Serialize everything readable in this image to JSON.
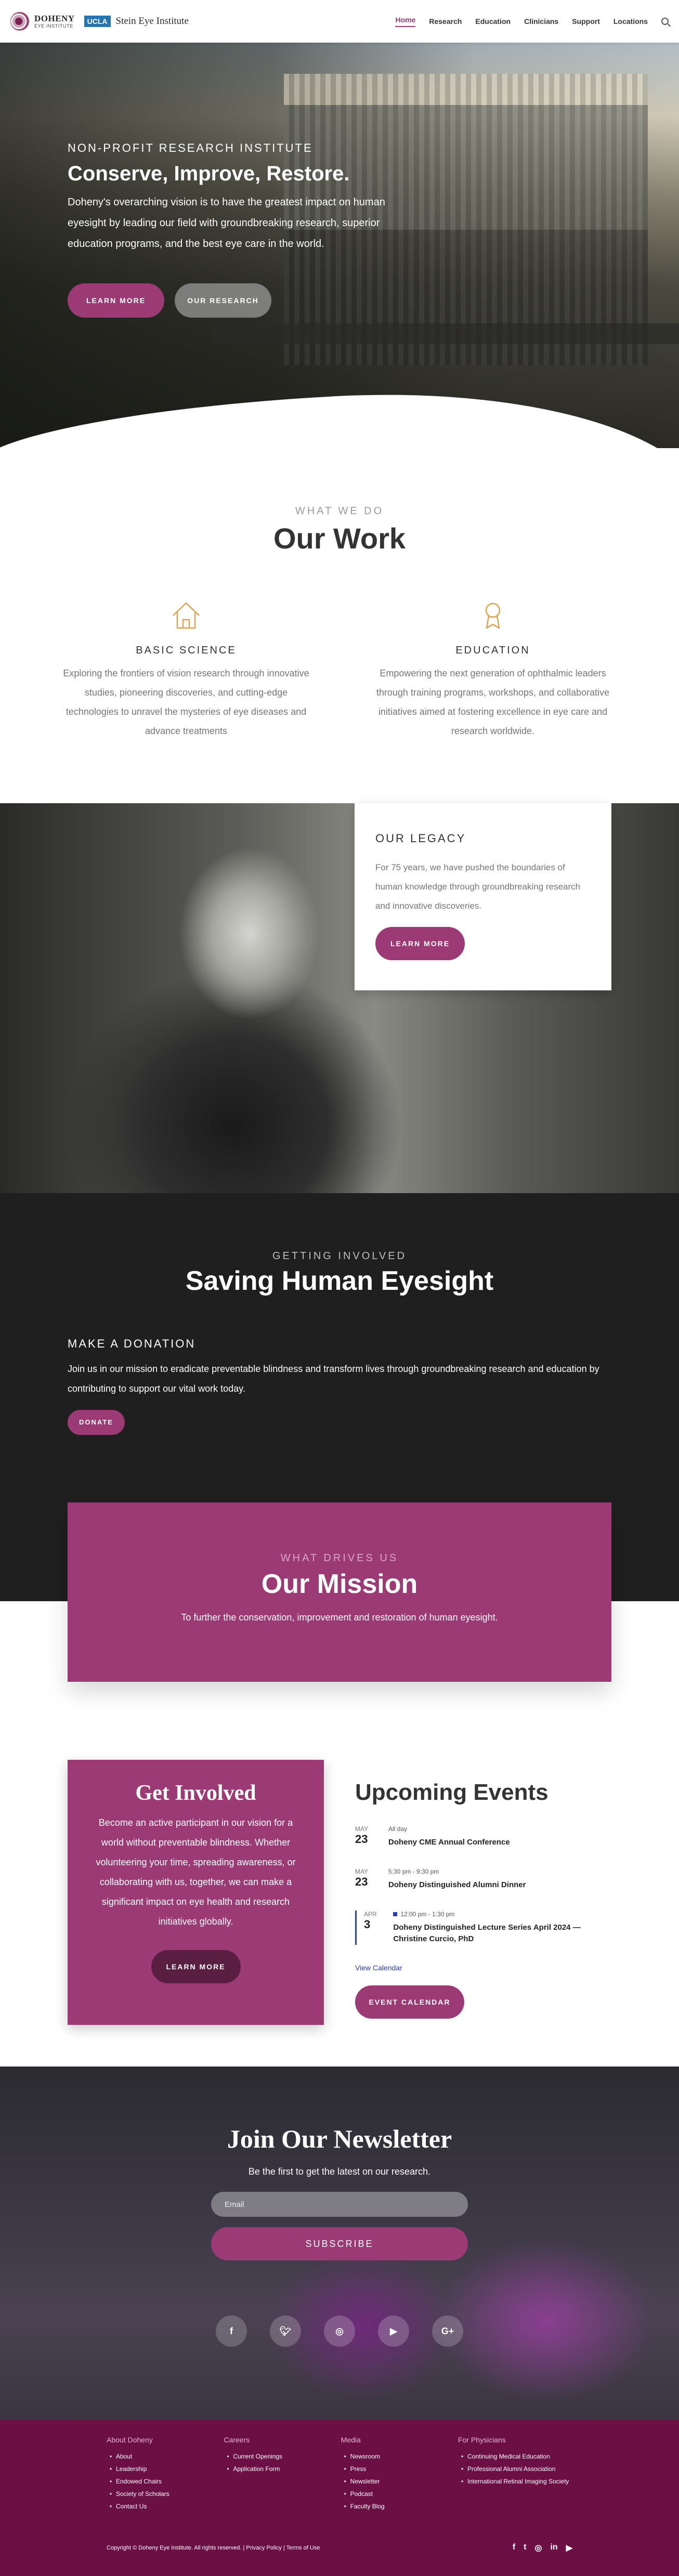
{
  "header": {
    "logo_doheny": "DOHENY",
    "logo_institute": "EYE INSTITUTE",
    "logo_ucla": "UCLA",
    "logo_stein": "Stein Eye Institute",
    "nav": [
      "Home",
      "Research",
      "Education",
      "Clinicians",
      "Support",
      "Locations"
    ]
  },
  "hero": {
    "kicker": "NON-PROFIT RESEARCH INSTITUTE",
    "title": "Conserve, Improve, Restore.",
    "body": "Doheny's overarching vision is to have the greatest impact on human eyesight by leading our field with groundbreaking research, superior education programs, and the best eye care in the world.",
    "btn_learn": "LEARN MORE",
    "btn_research": "OUR RESEARCH"
  },
  "work": {
    "eyebrow": "WHAT WE DO",
    "title": "Our Work",
    "basic_title": "BASIC SCIENCE",
    "basic_body": "Exploring the frontiers of vision research through innovative studies, pioneering discoveries, and cutting-edge technologies to unravel the mysteries of eye diseases and advance treatments",
    "edu_title": "EDUCATION",
    "edu_body": "Empowering the next generation of ophthalmic leaders through training programs, workshops, and collaborative initiatives aimed at fostering excellence in eye care and research worldwide."
  },
  "legacy": {
    "title": "OUR LEGACY",
    "body": "For 75 years, we have pushed the boundaries of human knowledge through groundbreaking research and innovative discoveries.",
    "btn": "LEARN MORE"
  },
  "involved": {
    "eyebrow": "GETTING INVOLVED",
    "title": "Saving Human Eyesight",
    "donation_title": "MAKE A DONATION",
    "donation_body": "Join us in our mission to eradicate preventable blindness and transform lives through groundbreaking research and education by contributing to support our vital work today.",
    "btn": "DONATE"
  },
  "mission": {
    "eyebrow": "WHAT DRIVES US",
    "title": "Our Mission",
    "body": "To further the conservation, improvement and restoration of human eyesight."
  },
  "get_involved": {
    "title": "Get Involved",
    "body": "Become an active participant in our vision for a world without preventable blindness. Whether volunteering your time, spreading awareness, or collaborating with us, together, we can make a significant impact on eye health and research initiatives globally.",
    "btn": "LEARN MORE"
  },
  "events": {
    "title": "Upcoming Events",
    "items": [
      {
        "month": "MAY",
        "day": "23",
        "time": "All day",
        "name": "Doheny CME Annual Conference"
      },
      {
        "month": "MAY",
        "day": "23",
        "time": "5:30 pm - 9:30 pm",
        "name": "Doheny Distinguished Alumni Dinner"
      },
      {
        "month": "APR",
        "day": "3",
        "time": "12:00 pm - 1:30 pm",
        "name": "Doheny Distinguished Lecture Series April 2024 — Christine Curcio, PhD"
      }
    ],
    "view_calendar": "View Calendar",
    "btn": "EVENT CALENDAR"
  },
  "newsletter": {
    "title": "Join Our Newsletter",
    "sub": "Be the first to get the latest on our research.",
    "placeholder": "Email",
    "btn": "SUBSCRIBE"
  },
  "footer": {
    "cols": [
      {
        "title": "About Doheny",
        "items": [
          "About",
          "Leadership",
          "Endowed Chairs",
          "Society of Scholars",
          "Contact Us"
        ]
      },
      {
        "title": "Careers",
        "items": [
          "Current Openings",
          "Application Form"
        ]
      },
      {
        "title": "Media",
        "items": [
          "Newsroom",
          "Press",
          "Newsletter",
          "Podcast",
          "Faculty Blog"
        ]
      },
      {
        "title": "For Physicians",
        "items": [
          "Continuing Medical Education",
          "Professional Alumni Association",
          "International Retinal Imaging Society"
        ]
      }
    ],
    "copyright": "Copyright © Doheny Eye Institute. All rights reserved. | Privacy Policy | Terms of Use"
  },
  "colors": {
    "accent": "#9b3a74",
    "footer": "#6c0f45",
    "dark": "#1f1f1f",
    "link": "#2c3cbf"
  }
}
